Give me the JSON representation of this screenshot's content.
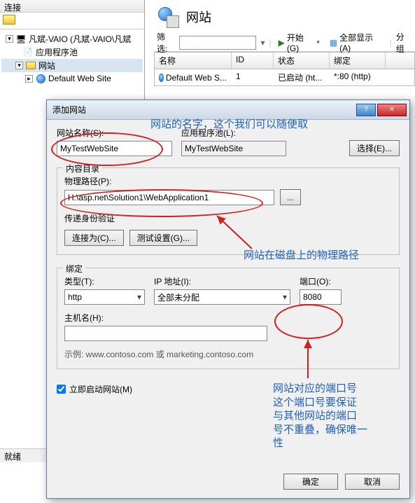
{
  "left": {
    "header": "连接",
    "server": "凡斌-VAIO (凡斌-VAIO\\凡斌",
    "apppools": "应用程序池",
    "sites": "网站",
    "defaultsite": "Default Web Site",
    "status": "就绪"
  },
  "main": {
    "title": "网站",
    "filterLabel": "筛选:",
    "startLabel": "开始(G)",
    "showAllLabel": "全部显示(A)",
    "groupLabel": "分组",
    "columns": {
      "name": "名称",
      "id": "ID",
      "status": "状态",
      "bind": "绑定"
    },
    "row": {
      "name": "Default Web S...",
      "id": "1",
      "status": "已启动 (ht...",
      "bind": "*:80 (http)"
    }
  },
  "dialog": {
    "title": "添加网站",
    "siteNameLabel": "网站名称(S):",
    "siteName": "MyTestWebSite",
    "appPoolLabel": "应用程序池(L):",
    "appPool": "MyTestWebSite",
    "selectBtn": "选择(E)...",
    "contentDir": "内容目录",
    "physicalPathLabel": "物理路径(P):",
    "physicalPath": "H:\\asp.net\\Solution1\\WebApplication1",
    "browseBtn": "...",
    "passthroughAuth": "传递身份验证",
    "connectAsBtn": "连接为(C)...",
    "testSettingsBtn": "测试设置(G)...",
    "binding": "绑定",
    "typeLabel": "类型(T):",
    "typeValue": "http",
    "ipLabel": "IP 地址(I):",
    "ipValue": "全部未分配",
    "portLabel": "端口(O):",
    "portValue": "8080",
    "hostLabel": "主机名(H):",
    "hostValue": "",
    "example": "示例: www.contoso.com 或 marketing.contoso.com",
    "startImmediately": "立即启动网站(M)",
    "ok": "确定",
    "cancel": "取消"
  },
  "annotations": {
    "a1": "网站的名字，这个我们可以随便取",
    "a2": "网站在磁盘上的物理路径",
    "a3": "网站对应的端口号\n这个端口号要保证\n与其他网站的端口\n号不重叠，确保唯一\n性"
  }
}
